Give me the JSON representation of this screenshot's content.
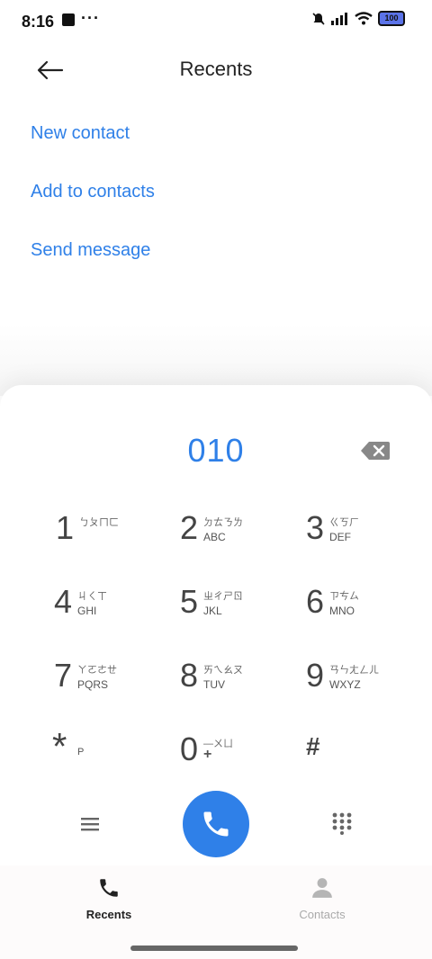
{
  "status_bar": {
    "time": "8:16",
    "dots": "···",
    "battery": "100"
  },
  "header": {
    "title": "Recents"
  },
  "actions": {
    "new_contact": "New contact",
    "add_to_contacts": "Add to contacts",
    "send_message": "Send message"
  },
  "dialer": {
    "number": "010",
    "keys": [
      {
        "digit": "1",
        "zhuyin": "ㄅㄆㄇㄈ",
        "letters": ""
      },
      {
        "digit": "2",
        "zhuyin": "ㄉㄊㄋㄌ",
        "letters": "ABC"
      },
      {
        "digit": "3",
        "zhuyin": "ㄍㄎㄏ",
        "letters": "DEF"
      },
      {
        "digit": "4",
        "zhuyin": "ㄐㄑㄒ",
        "letters": "GHI"
      },
      {
        "digit": "5",
        "zhuyin": "ㄓㄔㄕㄖ",
        "letters": "JKL"
      },
      {
        "digit": "6",
        "zhuyin": "ㄗㄘㄙ",
        "letters": "MNO"
      },
      {
        "digit": "7",
        "zhuyin": "ㄚㄛㄜㄝ",
        "letters": "PQRS"
      },
      {
        "digit": "8",
        "zhuyin": "ㄞㄟㄠㄡ",
        "letters": "TUV"
      },
      {
        "digit": "9",
        "zhuyin": "ㄢㄣㄤㄥㄦ",
        "letters": "WXYZ"
      },
      {
        "digit": "*",
        "zhuyin": "",
        "letters": "P"
      },
      {
        "digit": "0",
        "zhuyin": "—ㄨㄩ",
        "letters": "+"
      },
      {
        "digit": "#",
        "zhuyin": "",
        "letters": ""
      }
    ]
  },
  "bottom_nav": {
    "recents": {
      "label": "Recents",
      "color": "#222222"
    },
    "contacts": {
      "label": "Contacts",
      "color": "#aaaaaa"
    }
  },
  "colors": {
    "accent": "#2f80e8"
  }
}
